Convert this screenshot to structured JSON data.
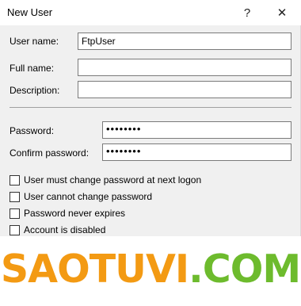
{
  "window": {
    "title": "New User",
    "help_glyph": "?",
    "close_glyph": "✕"
  },
  "form": {
    "user_name_label": "User name:",
    "user_name_value": "FtpUser",
    "full_name_label": "Full name:",
    "full_name_value": "",
    "description_label": "Description:",
    "description_value": "",
    "password_label": "Password:",
    "password_value": "••••••••",
    "confirm_label": "Confirm password:",
    "confirm_value": "••••••••"
  },
  "options": [
    {
      "label": "User must change password at next logon",
      "checked": false
    },
    {
      "label": "User cannot change password",
      "checked": false
    },
    {
      "label": "Password never expires",
      "checked": false
    },
    {
      "label": "Account is disabled",
      "checked": false
    }
  ],
  "watermark": {
    "part1": "SAOTUVI",
    "dot": ".",
    "part2": "COM"
  }
}
